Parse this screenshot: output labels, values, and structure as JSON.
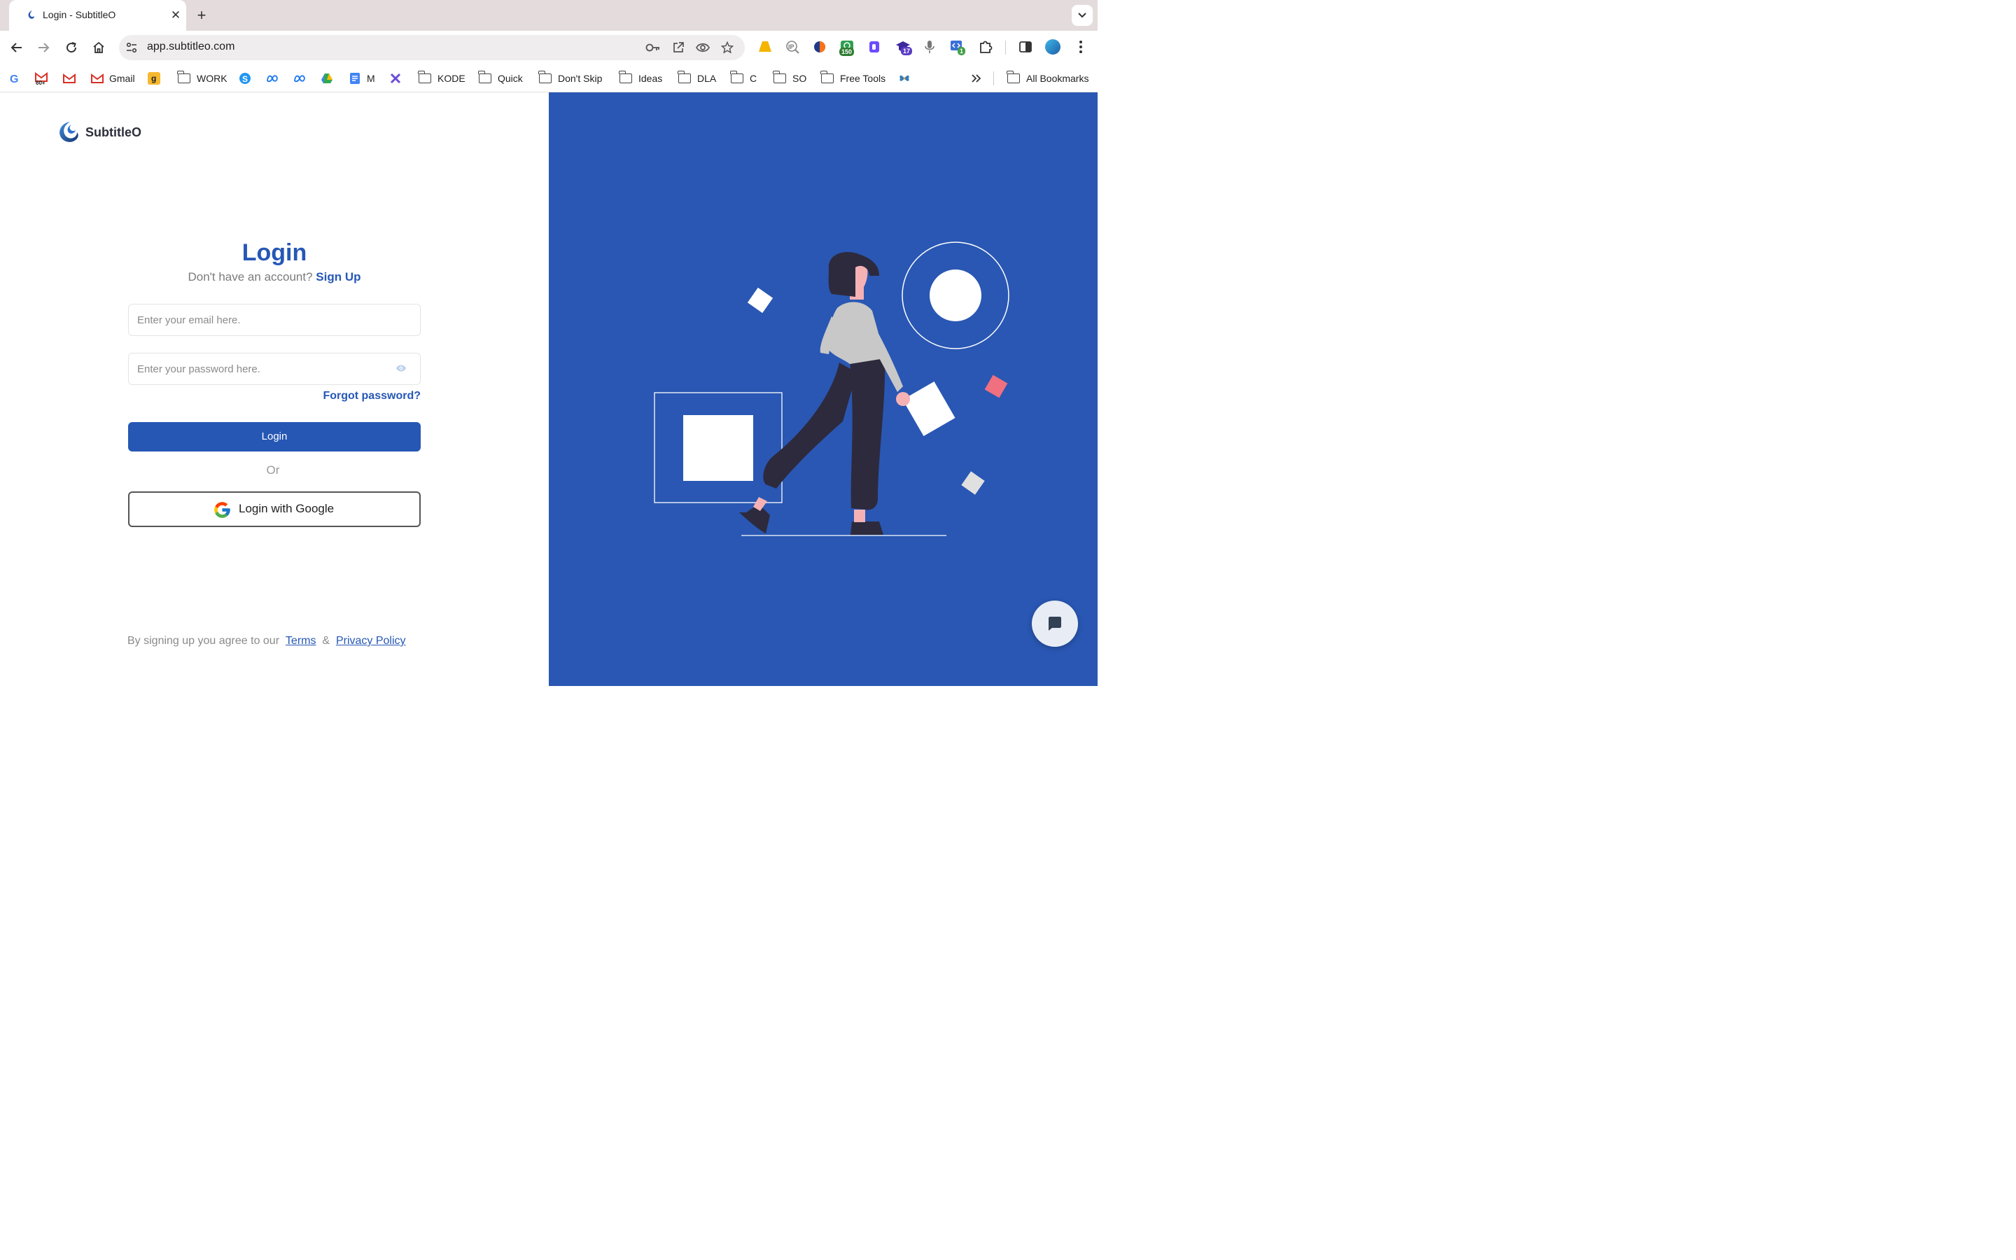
{
  "browser": {
    "tab_title": "Login - SubtitleO",
    "url": "app.subtitleo.com",
    "bookmarks": {
      "gmail": "Gmail",
      "work": "WORK",
      "m": "M",
      "kode": "KODE",
      "quick": "Quick",
      "dont_skip": "Don't Skip",
      "ideas": "Ideas",
      "dla": "DLA",
      "c": "C",
      "so": "SO",
      "free_tools": "Free Tools",
      "all_bookmarks": "All Bookmarks",
      "gmail_badge": "60+"
    },
    "extension_badges": {
      "money": "150",
      "cap": "17",
      "code": "1"
    }
  },
  "app": {
    "brand": "SubtitleO",
    "title": "Login",
    "signup_prompt": "Don't have an account?",
    "signup_link": "Sign Up",
    "email_placeholder": "Enter your email here.",
    "password_placeholder": "Enter your password here.",
    "forgot_password": "Forgot password?",
    "login_button": "Login",
    "or": "Or",
    "google_button": "Login with Google",
    "footer_prefix": "By signing up you agree to our",
    "terms": "Terms",
    "amp": "&",
    "privacy": "Privacy Policy"
  },
  "colors": {
    "brand_blue": "#2657b5",
    "panel_blue": "#2957b3",
    "accent_pink": "#f07080"
  }
}
